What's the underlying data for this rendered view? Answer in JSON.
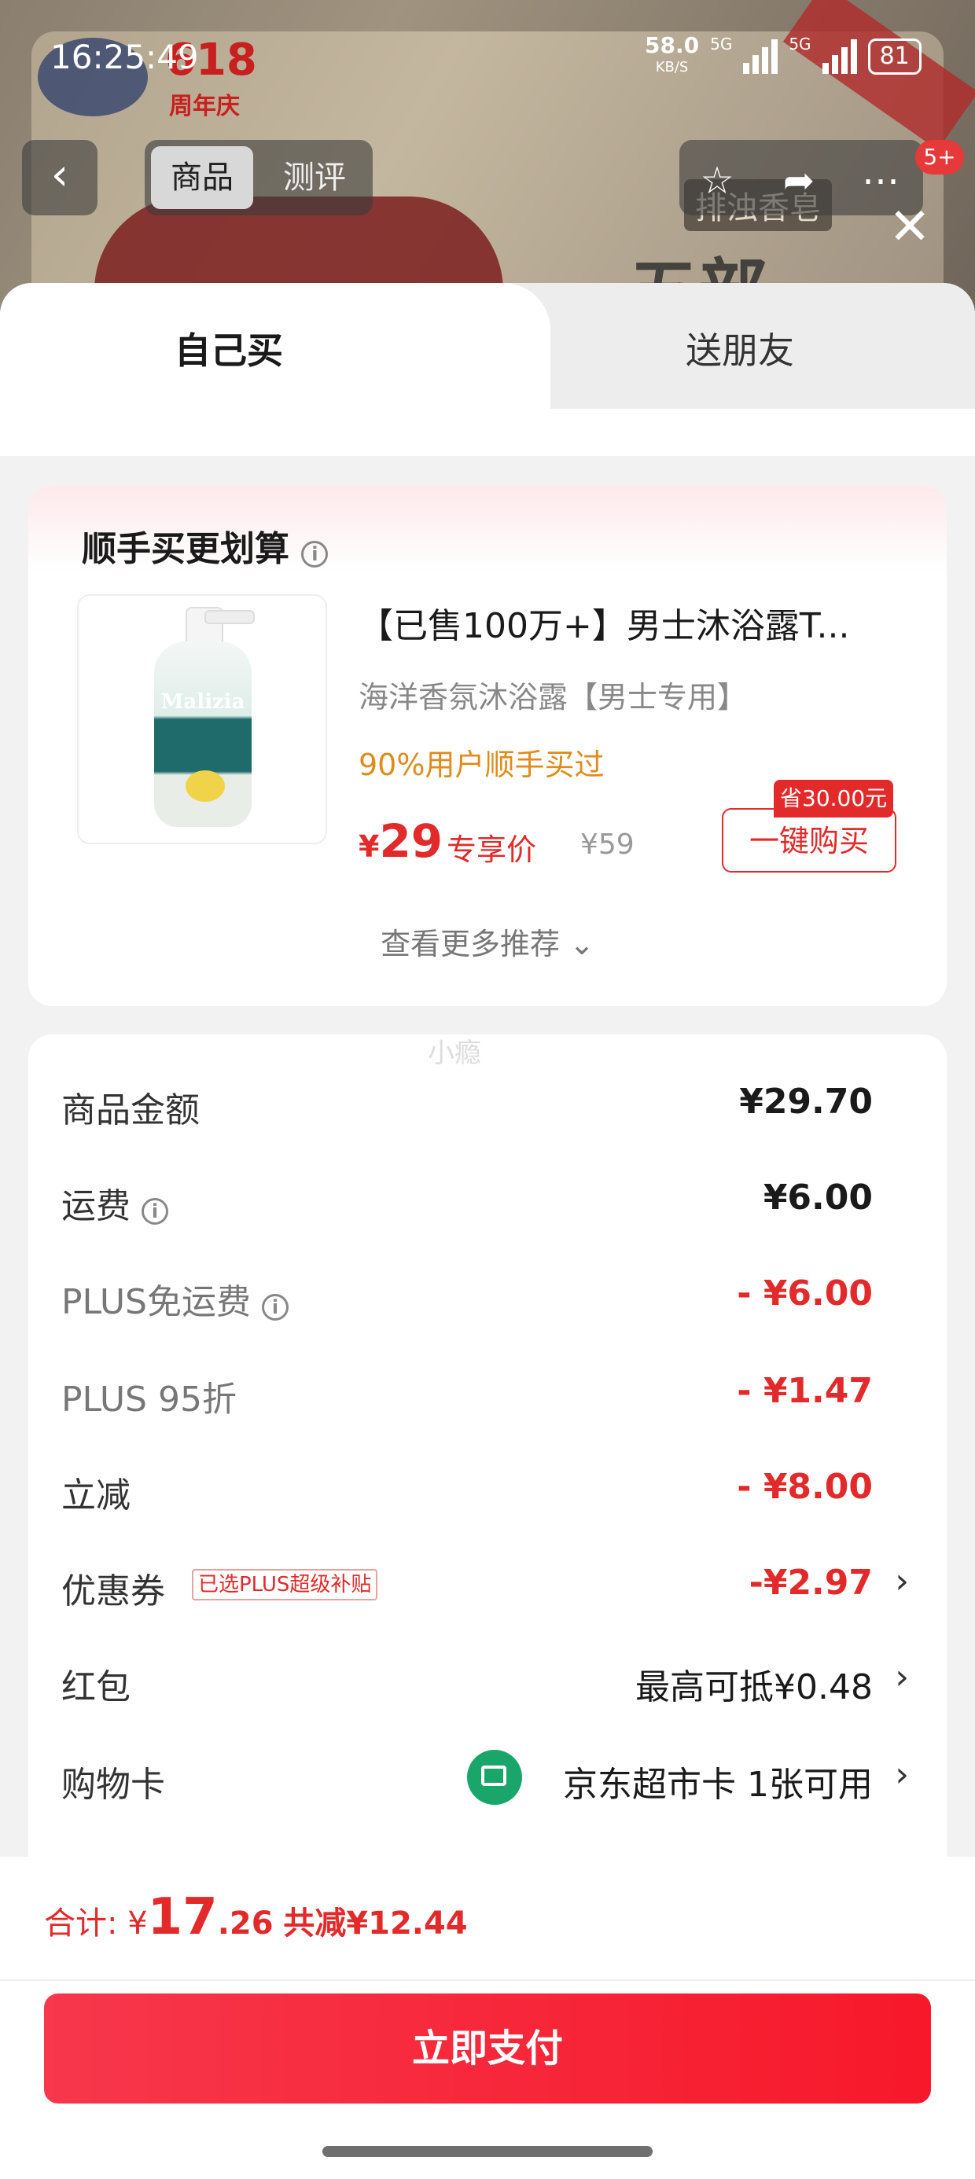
{
  "status_bar": {
    "time": "16:25:49",
    "net_speed": "58.0",
    "net_unit": "KB/S",
    "sig1": "5G",
    "sig2": "5G",
    "battery": "81"
  },
  "background": {
    "brand_event": "618",
    "brand_event_sub": "周年庆",
    "tag": "排浊香皂",
    "title": "五部"
  },
  "nav": {
    "back_icon": "chevron-left-icon",
    "tabs": [
      "商品",
      "测评"
    ],
    "badge": "5+"
  },
  "sheet_tabs": {
    "self": "自己买",
    "friend": "送朋友"
  },
  "recommend": {
    "title": "顺手买更划算",
    "product_name": "【已售100万+】男士沐浴露T...",
    "product_sub": "海洋香氛沐浴露【男士专用】",
    "hint": "90%用户顺手买过",
    "price_symbol": "¥",
    "price": "29",
    "price_label": "专享价",
    "orig_price": "¥59",
    "save_tag": "省30.00元",
    "buy_label": "一键购买",
    "more_label": "查看更多推荐 ⌄",
    "image_brand": "Malizia"
  },
  "watermark": "小瘾",
  "fees": [
    {
      "label": "商品金额",
      "value": "¥29.70"
    },
    {
      "label": "运费",
      "value": "¥6.00"
    },
    {
      "label": "PLUS免运费",
      "value": "- ¥6.00"
    },
    {
      "label": "PLUS 95折",
      "value": "- ¥1.47"
    },
    {
      "label": "立减",
      "value": "- ¥8.00"
    },
    {
      "label": "优惠券",
      "value": "-¥2.97",
      "tag": "已选PLUS超级补贴"
    },
    {
      "label": "红包",
      "value": "最高可抵¥0.48"
    },
    {
      "label": "购物卡",
      "value": "京东超市卡 1张可用"
    }
  ],
  "footer": {
    "total_prefix": "合计: ¥",
    "total_int": "17",
    "total_dec": ".26",
    "saved": "共减¥12.44",
    "pay_label": "立即支付"
  }
}
